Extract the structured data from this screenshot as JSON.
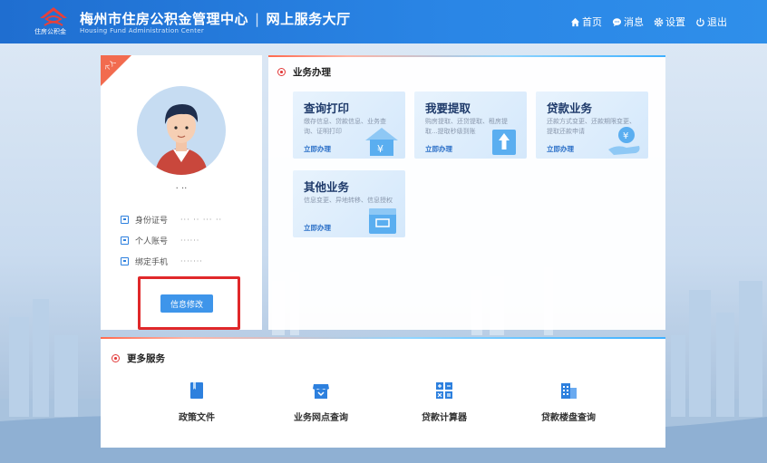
{
  "header": {
    "logo_text": "住房公积金",
    "title": "梅州市住房公积金管理中心",
    "divider": "|",
    "portal": "网上服务大厅",
    "subtitle": "Housing Fund Administration Center",
    "nav": [
      {
        "label": "首页",
        "icon": "home-icon"
      },
      {
        "label": "消息",
        "icon": "message-icon"
      },
      {
        "label": "设置",
        "icon": "gear-icon"
      },
      {
        "label": "退出",
        "icon": "power-icon"
      }
    ]
  },
  "profile": {
    "corner_badge": "个人",
    "username": "· ··",
    "rows": [
      {
        "label": "身份证号",
        "value": "··· ·· ··· ··",
        "icon": "id-card-icon"
      },
      {
        "label": "个人账号",
        "value": "······",
        "icon": "account-icon"
      },
      {
        "label": "绑定手机",
        "value": "·······",
        "icon": "phone-icon"
      }
    ],
    "edit_button": "信息修改"
  },
  "business": {
    "heading": "业务办理",
    "tiles": [
      {
        "title": "查询打印",
        "desc": "缴存信息、贷款信息、业务查询、证明打印",
        "link": "立即办理",
        "icon": "house-yuan-icon"
      },
      {
        "title": "我要提取",
        "desc": "购房提取、还贷提取、租房提取...提取秒级到账",
        "link": "立即办理",
        "icon": "withdraw-icon"
      },
      {
        "title": "贷款业务",
        "desc": "还款方式变更、还款期限变更、提取还款申请",
        "link": "立即办理",
        "icon": "loan-hand-icon"
      },
      {
        "title": "其他业务",
        "desc": "信息变更、异地转移、信息授权",
        "link": "立即办理",
        "icon": "box-icon"
      }
    ]
  },
  "more": {
    "heading": "更多服务",
    "items": [
      {
        "label": "政策文件",
        "icon": "book-icon"
      },
      {
        "label": "业务网点查询",
        "icon": "store-icon"
      },
      {
        "label": "贷款计算器",
        "icon": "calculator-icon"
      },
      {
        "label": "贷款楼盘查询",
        "icon": "building-icon"
      }
    ]
  },
  "colors": {
    "header_blue": "#2a86e6",
    "accent_red": "#e23a3a",
    "button_blue": "#3e95ea",
    "highlight_red": "#e0282a"
  }
}
